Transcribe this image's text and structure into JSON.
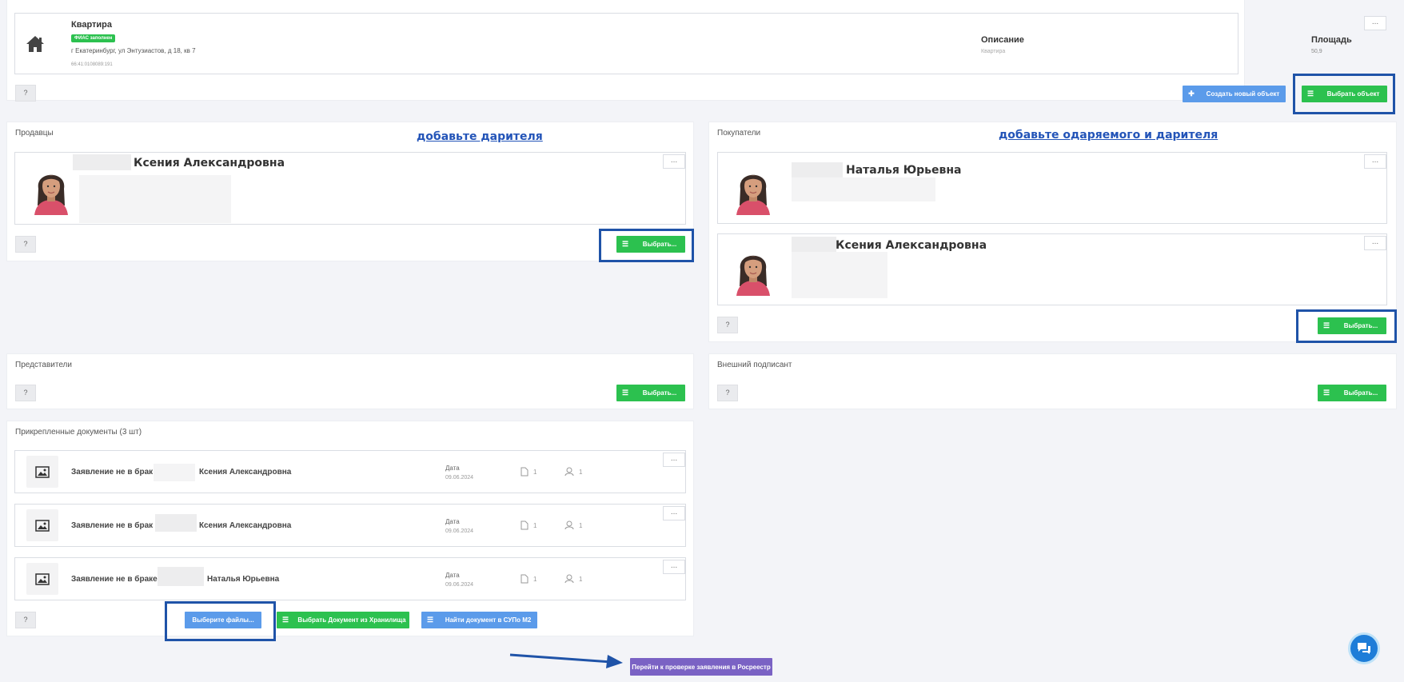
{
  "object": {
    "title": "Квартира",
    "badge": "ФИАС заполнен",
    "address": "г Екатеринбург, ул Энтузиастов, д 18, кв 7",
    "cadastral": "66:41:0108089:191",
    "desc_label": "Описание",
    "desc_value": "Квартира",
    "area_label": "Площадь",
    "area_value": "50,9",
    "dots": "...",
    "help": "?",
    "create_btn": "Создать новый объект",
    "select_btn": "Выбрать объект"
  },
  "sellers": {
    "title": "Продавцы",
    "note": "добавьте дарителя",
    "person_name": "Ксения Александровна",
    "dots": "...",
    "help": "?",
    "select_btn": "Выбрать..."
  },
  "buyers": {
    "title": "Покупатели",
    "note": "добавьте одаряемого и дарителя",
    "persons": [
      {
        "name": "Наталья Юрьевна"
      },
      {
        "name": "Ксения Александровна"
      }
    ],
    "dots": "...",
    "help": "?",
    "select_btn": "Выбрать..."
  },
  "representatives": {
    "title": "Представители",
    "help": "?",
    "select_btn": "Выбрать..."
  },
  "external_signer": {
    "title": "Внешний подписант",
    "help": "?",
    "select_btn": "Выбрать..."
  },
  "documents": {
    "title": "Прикрепленные документы (3 шт)",
    "date_label": "Дата",
    "items": [
      {
        "title_prefix": "Заявление не в брак",
        "title_suffix": "Ксения Александровна",
        "date": "09.06.2024",
        "files": "1",
        "signers": "1"
      },
      {
        "title_prefix": "Заявление не в брак",
        "title_suffix": "Ксения Александровна",
        "date": "09.06.2024",
        "files": "1",
        "signers": "1"
      },
      {
        "title_prefix": "Заявление не в браке",
        "title_suffix": "Наталья Юрьевна",
        "date": "09.06.2024",
        "files": "1",
        "signers": "1"
      }
    ],
    "dots": "...",
    "help": "?",
    "choose_files_btn": "Выберите файлы...",
    "storage_btn": "Выбрать Документ из Хранилища",
    "supo_btn": "Найти документ в СУПо М2"
  },
  "footer": {
    "proceed_btn": "Перейти к проверке заявления в Росреестр"
  }
}
